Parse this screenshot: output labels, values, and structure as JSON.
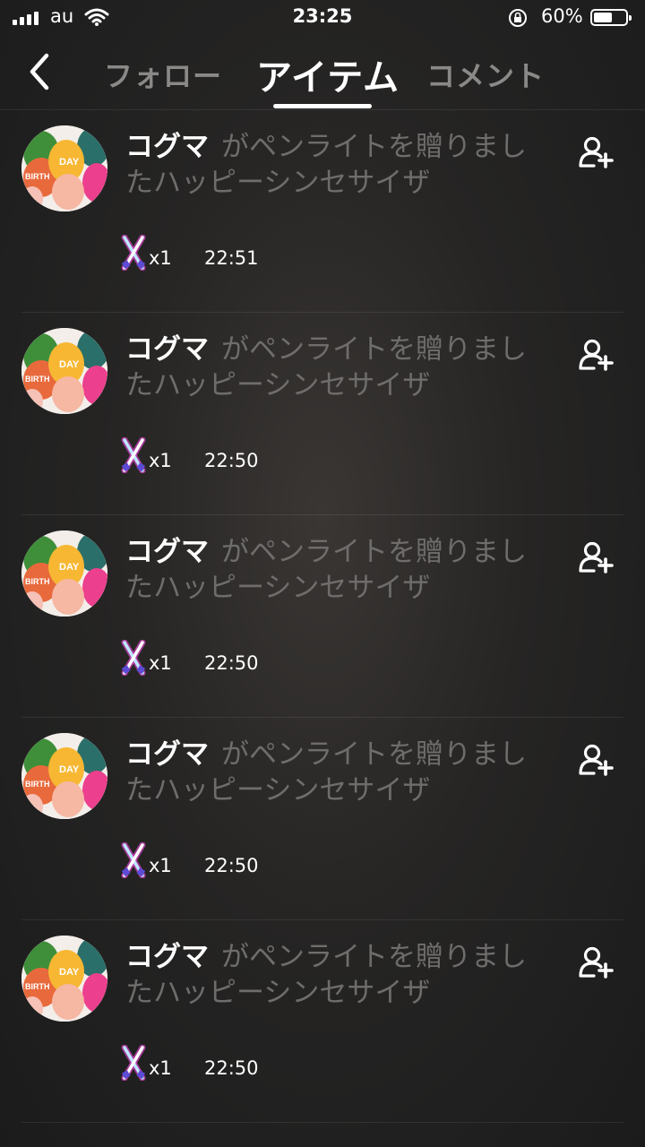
{
  "status_bar": {
    "carrier": "au",
    "time": "23:25",
    "battery_percent": "60%",
    "battery_level": 0.6
  },
  "header": {
    "back_icon": "chevron-left-icon",
    "tabs": [
      {
        "label": "フォロー",
        "active": false
      },
      {
        "label": "アイテム",
        "active": true
      },
      {
        "label": "コメント",
        "active": false
      }
    ]
  },
  "gifts": [
    {
      "user": "コグマ",
      "message": "がペンライトを贈りましたハッピーシンセサイザ",
      "quantity": "x1",
      "time": "22:51"
    },
    {
      "user": "コグマ",
      "message": "がペンライトを贈りましたハッピーシンセサイザ",
      "quantity": "x1",
      "time": "22:50"
    },
    {
      "user": "コグマ",
      "message": "がペンライトを贈りましたハッピーシンセサイザ",
      "quantity": "x1",
      "time": "22:50"
    },
    {
      "user": "コグマ",
      "message": "がペンライトを贈りましたハッピーシンセサイザ",
      "quantity": "x1",
      "time": "22:50"
    },
    {
      "user": "コグマ",
      "message": "がペンライトを贈りましたハッピーシンセサイザ",
      "quantity": "x1",
      "time": "22:50"
    }
  ],
  "icons": {
    "add_user": "add-user-icon",
    "item": "penlight-icon",
    "avatar_text": [
      "BIRTH",
      "DAY"
    ]
  }
}
